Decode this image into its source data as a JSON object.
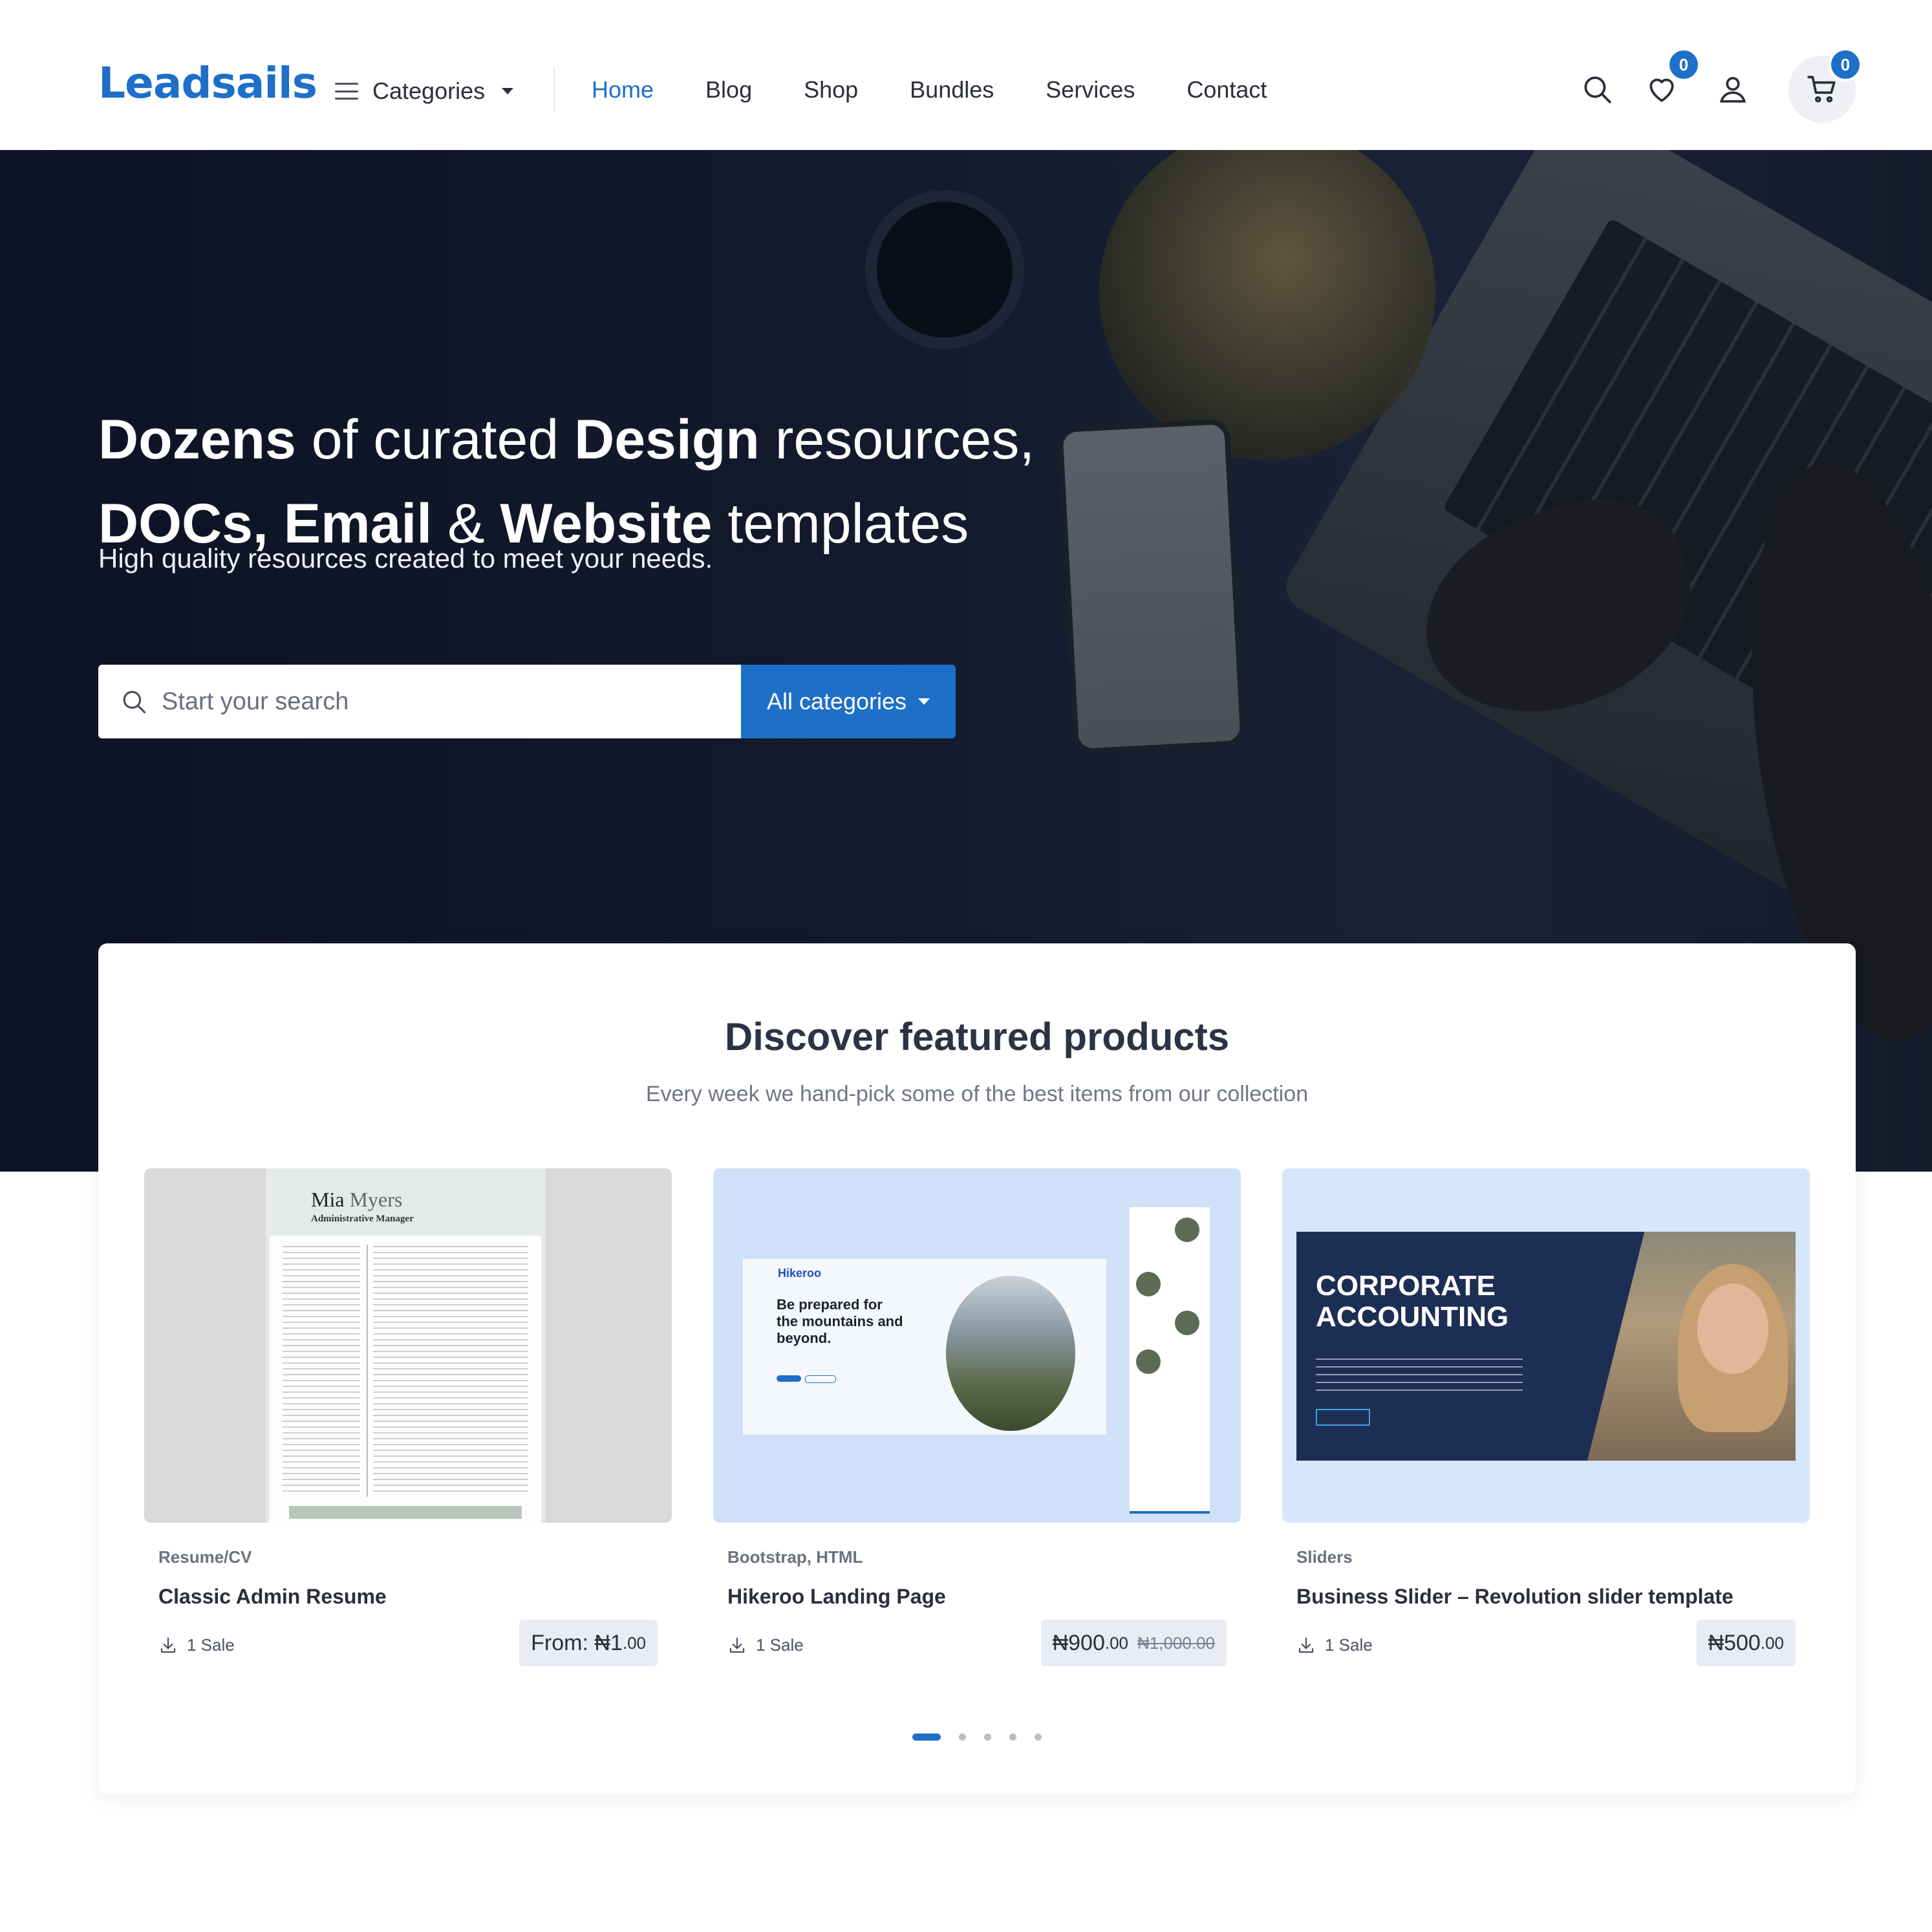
{
  "header": {
    "logo": "Leadsails",
    "categories_label": "Categories",
    "nav": [
      {
        "label": "Home",
        "active": true
      },
      {
        "label": "Blog"
      },
      {
        "label": "Shop"
      },
      {
        "label": "Bundles"
      },
      {
        "label": "Services"
      },
      {
        "label": "Contact"
      }
    ],
    "wishlist_count": "0",
    "cart_count": "0",
    "icons": [
      "search-icon",
      "heart-icon",
      "user-icon",
      "cart-icon"
    ]
  },
  "hero": {
    "title_line1": [
      {
        "text": "Dozens",
        "bold": true
      },
      {
        "text": " of curated ",
        "bold": false
      },
      {
        "text": "Design",
        "bold": true
      },
      {
        "text": " resources,",
        "bold": false
      }
    ],
    "title_line2": [
      {
        "text": "DOCs, Email",
        "bold": true
      },
      {
        "text": " & ",
        "bold": false
      },
      {
        "text": "Website",
        "bold": true
      },
      {
        "text": " templates",
        "bold": false
      }
    ],
    "subtitle": "High quality resources created to meet your needs.",
    "search_placeholder": "Start your search",
    "search_category": "All categories"
  },
  "featured": {
    "title": "Discover featured products",
    "subtitle": "Every week we hand-pick some of the best items from our collection",
    "products": [
      {
        "category": "Resume/CV",
        "name": "Classic Admin Resume",
        "sales": "1 Sale",
        "price_prefix": "From: ₦1",
        "price_cents": ".00",
        "old_price": "",
        "thumb": {
          "name_first": "Mia",
          "name_last": "Myers",
          "role": "Administrative Manager"
        }
      },
      {
        "category": "Bootstrap, HTML",
        "name": "Hikeroo Landing Page",
        "sales": "1 Sale",
        "price_prefix": "₦900",
        "price_cents": ".00",
        "old_price": "₦1,000.00",
        "thumb": {
          "logo": "Hikeroo",
          "headline": "Be prepared for the mountains and beyond."
        }
      },
      {
        "category": "Sliders",
        "name": "Business Slider – Revolution slider template",
        "sales": "1 Sale",
        "price_prefix": "₦500",
        "price_cents": ".00",
        "old_price": "",
        "thumb": {
          "title": "CORPORATE ACCOUNTING"
        }
      }
    ],
    "carousel": {
      "pages": 5,
      "active": 0
    }
  },
  "colors": {
    "accent": "#1e6fc8",
    "hero_bg": "#121a2c",
    "text": "#2b2f3a"
  }
}
